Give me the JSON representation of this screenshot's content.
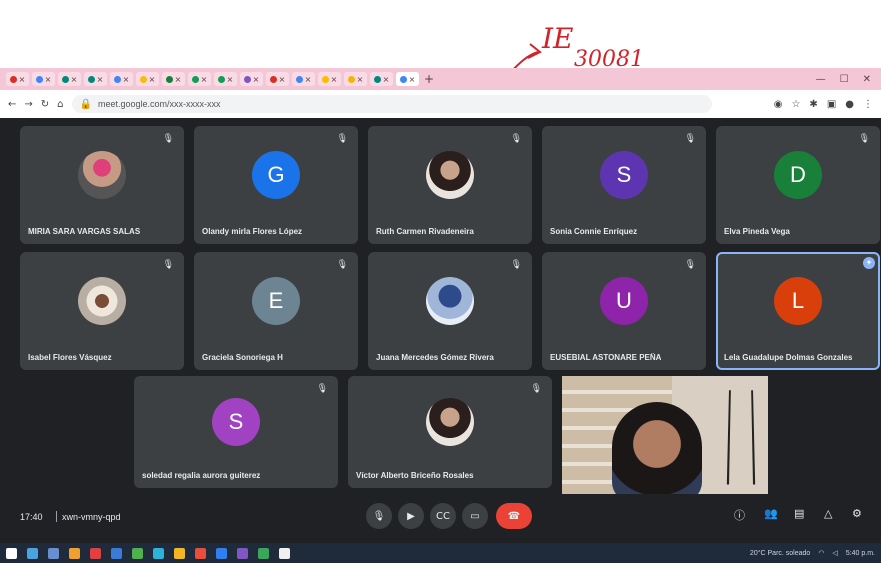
{
  "annotation": {
    "line1": "IE",
    "line2": "30081",
    "color": "#d2232a"
  },
  "browser": {
    "tab_icons": [
      "mail",
      "doc",
      "meet",
      "meet",
      "doc",
      "drive",
      "classroom",
      "sheet",
      "sheet",
      "forms",
      "mail",
      "doc",
      "drive",
      "slides",
      "meet",
      "doc"
    ],
    "address": "meet.google.com/xxx-xxxx-xxx",
    "nav_icons": [
      "back-arrow-icon",
      "forward-arrow-icon",
      "reload-icon",
      "home-icon"
    ]
  },
  "meet": {
    "participants": [
      {
        "name": "MIRIA SARA VARGAS SALAS",
        "kind": "photo",
        "photo": "pink"
      },
      {
        "name": "Olandy mirla Flores López",
        "kind": "letter",
        "letter": "G",
        "color": "#1a73e8"
      },
      {
        "name": "Ruth Carmen Rivadeneira",
        "kind": "photo",
        "photo": "woman"
      },
      {
        "name": "Sonia Connie Enríquez",
        "kind": "letter",
        "letter": "S",
        "color": "#5e35b1"
      },
      {
        "name": "Elva Pineda Vega",
        "kind": "letter",
        "letter": "D",
        "color": "#188038"
      },
      {
        "name": "Isabel Flores Vásquez",
        "kind": "photo",
        "photo": "cup"
      },
      {
        "name": "Graciela Sonoriega H",
        "kind": "letter",
        "letter": "E",
        "color": "#6d8592"
      },
      {
        "name": "Juana Mercedes Gómez Rivera",
        "kind": "photo",
        "photo": "group"
      },
      {
        "name": "EUSEBIAL ASTONARE PEÑA",
        "kind": "letter",
        "letter": "U",
        "color": "#8e24aa"
      },
      {
        "name": "Lela Guadalupe Dolmas Gonzales",
        "kind": "letter",
        "letter": "L",
        "color": "#d93f0b",
        "pinned": true
      },
      {
        "name": "soledad regalia aurora guiterez",
        "kind": "letter",
        "letter": "S",
        "color": "#a142c2"
      },
      {
        "name": "Víctor Alberto Briceño Rosales",
        "kind": "photo",
        "photo": "woman"
      }
    ],
    "time": "17:40",
    "meeting_code": "xwn-vmny-qpd"
  },
  "taskbar": {
    "icon_colors": [
      "#ffffff",
      "#4aa3df",
      "#6a8fd1",
      "#f0a030",
      "#e04040",
      "#3a7bd5",
      "#50b050",
      "#2bb3d9",
      "#f2b824",
      "#e94e3c",
      "#2f80ed",
      "#7e57c2",
      "#3ca55c",
      "#f0f0f0"
    ],
    "weather": "20°C  Parc. soleado",
    "clock": "5:40 p.m."
  }
}
